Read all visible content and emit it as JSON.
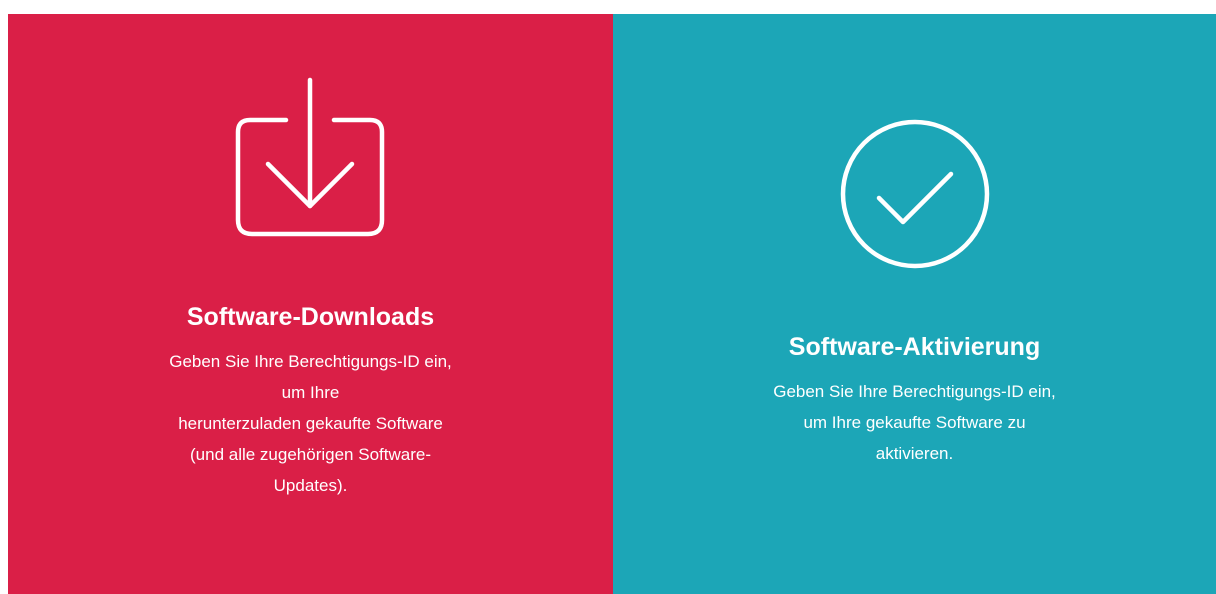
{
  "colors": {
    "downloads_bg": "#da1f47",
    "activation_bg": "#1ca6b7",
    "text": "#ffffff"
  },
  "tiles": [
    {
      "icon": "download-icon",
      "title": "Software-Downloads",
      "description_lines": [
        "Geben Sie Ihre Berechtigungs-ID ein,",
        "um Ihre",
        "herunterzuladen gekaufte Software",
        "(und alle zugehörigen Software-",
        "Updates)."
      ]
    },
    {
      "icon": "checkmark-circle-icon",
      "title": "Software-Aktivierung",
      "description_lines": [
        "Geben Sie Ihre Berechtigungs-ID ein,",
        "um Ihre gekaufte Software zu",
        "aktivieren."
      ]
    }
  ]
}
